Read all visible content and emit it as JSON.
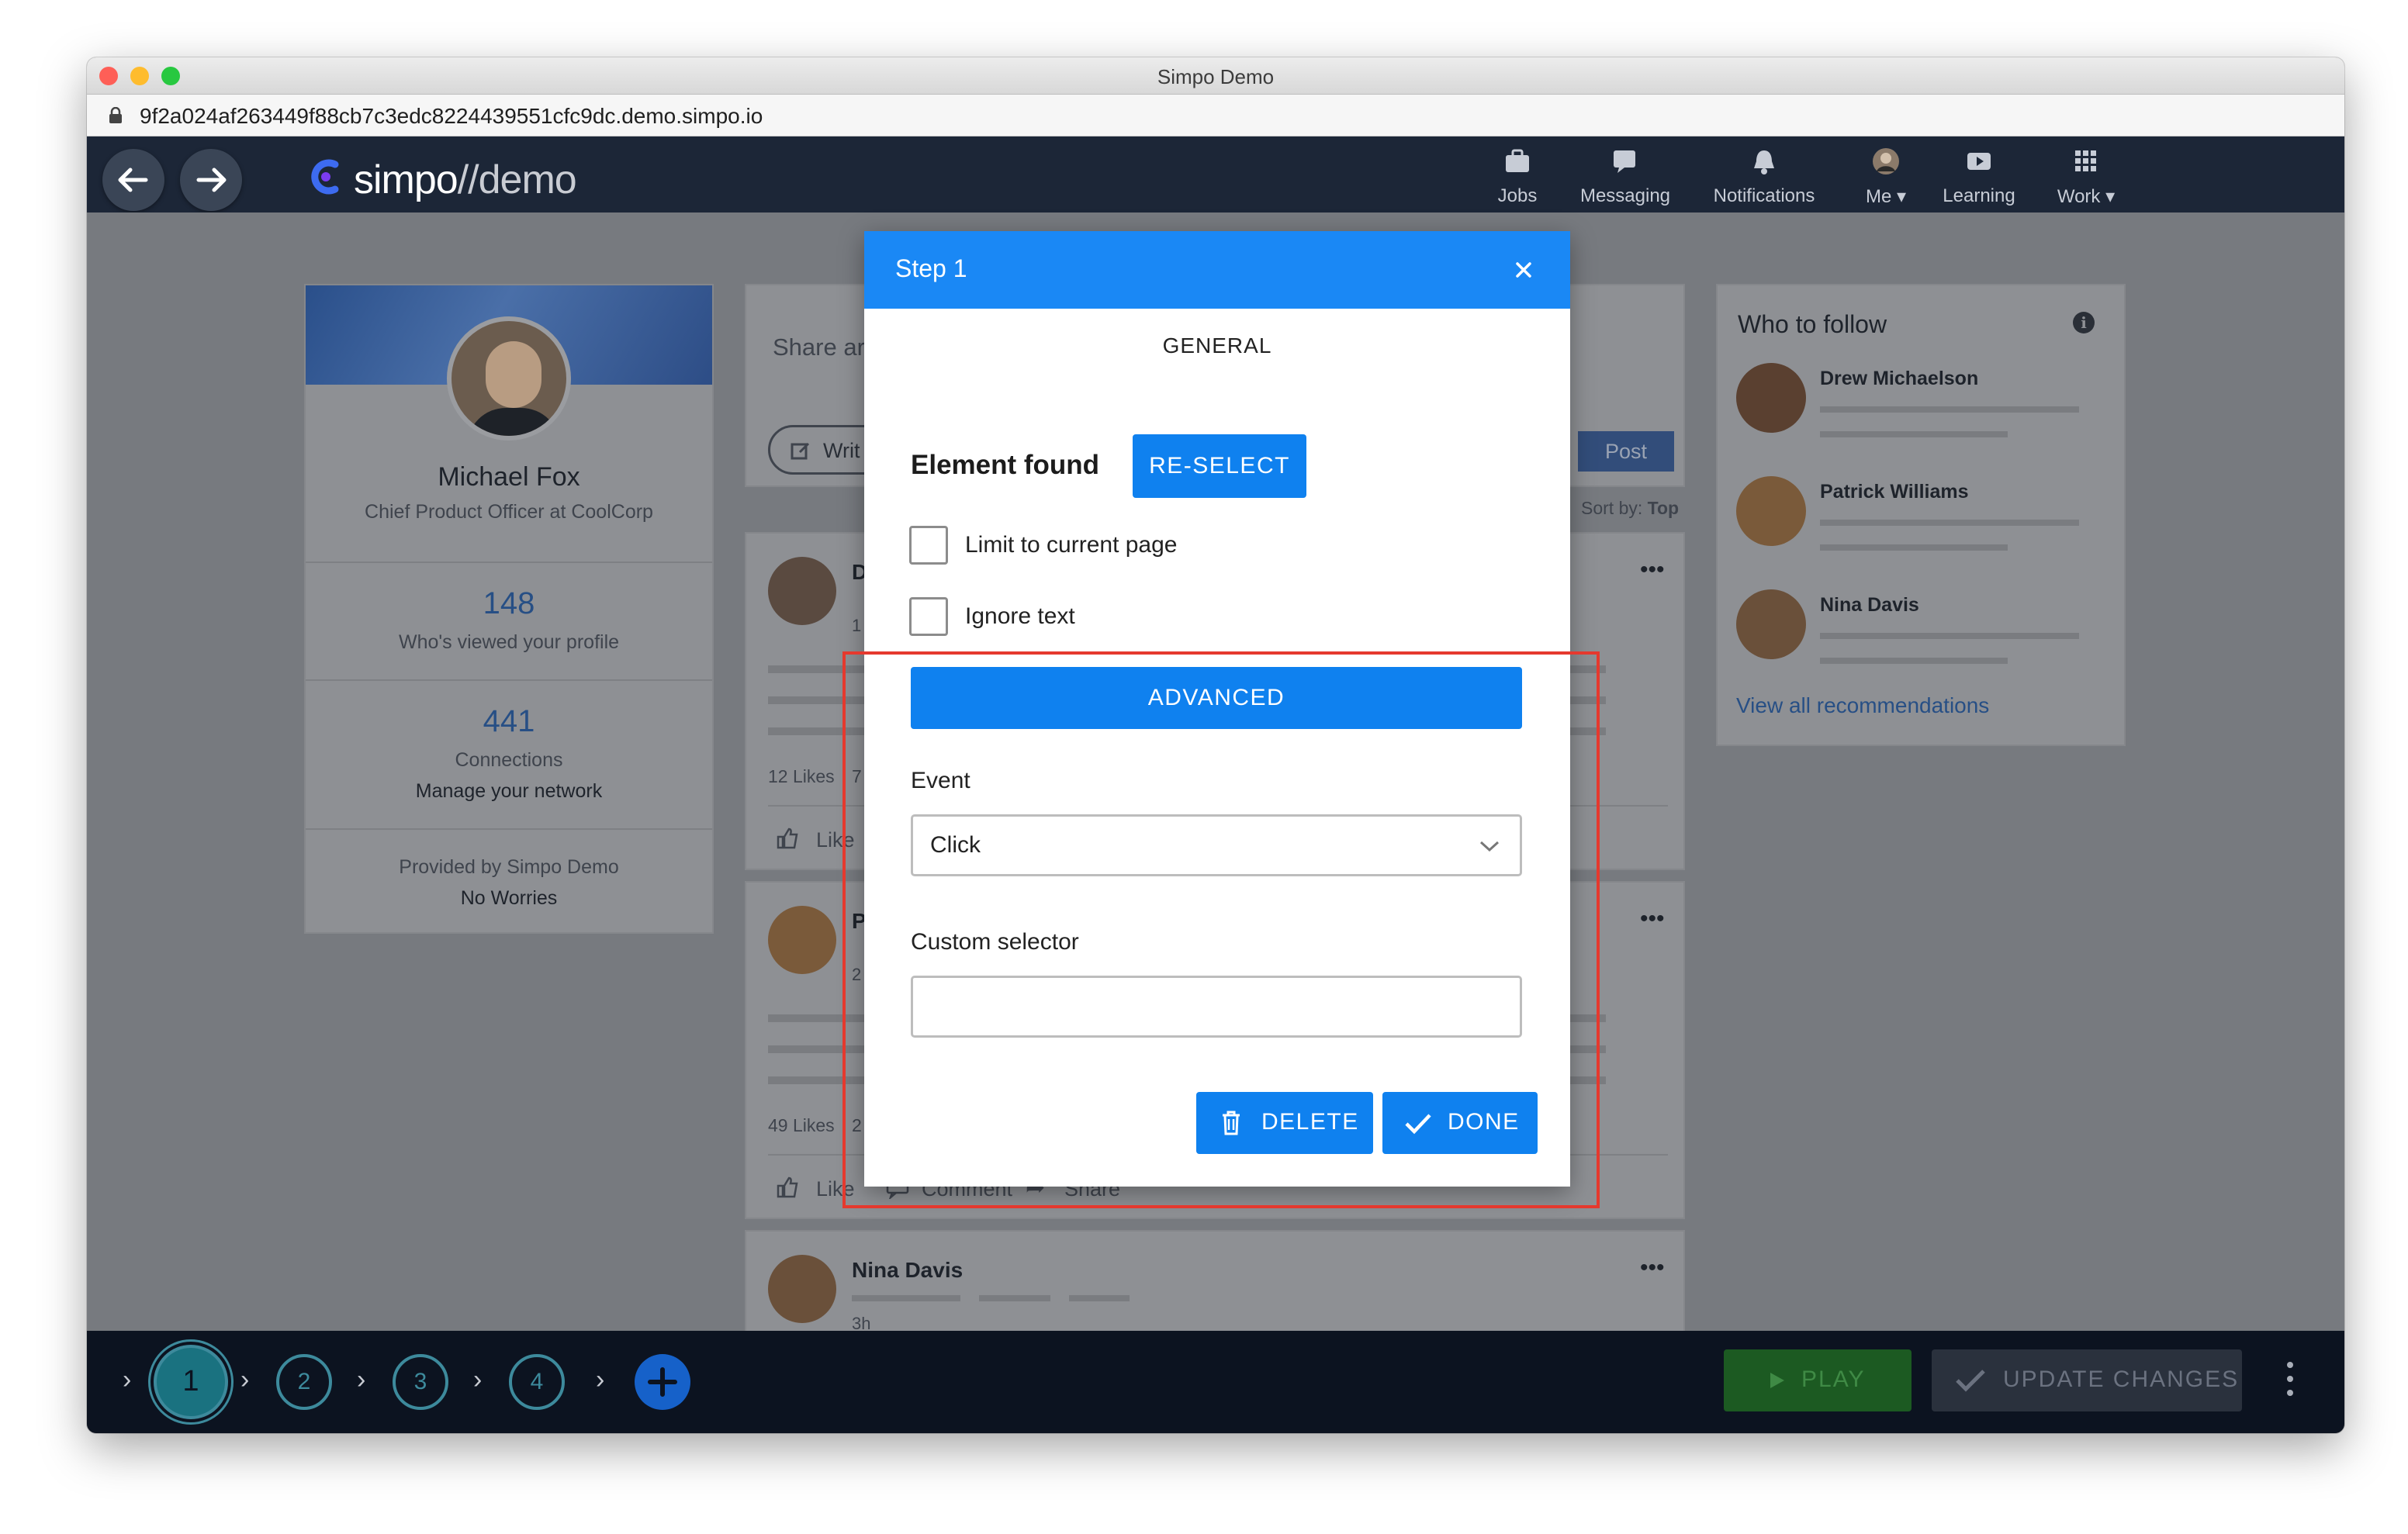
{
  "window": {
    "title": "Simpo Demo",
    "url": "9f2a024af263449f88cb7c3edc8224439551cfc9dc.demo.simpo.io"
  },
  "app": {
    "logo_main": "simpo",
    "logo_suffix": "//demo",
    "nav": [
      {
        "label": "Jobs",
        "icon": "briefcase-icon"
      },
      {
        "label": "Messaging",
        "icon": "chat-icon"
      },
      {
        "label": "Notifications",
        "icon": "bell-icon"
      },
      {
        "label": "Me ▾",
        "icon": "avatar-icon"
      },
      {
        "label": "Learning",
        "icon": "play-icon"
      },
      {
        "label": "Work ▾",
        "icon": "grid-icon"
      }
    ]
  },
  "profile": {
    "name": "Michael Fox",
    "title": "Chief Product Officer at CoolCorp",
    "views_count": "148",
    "views_label": "Who's viewed your profile",
    "connections_count": "441",
    "connections_label": "Connections",
    "manage_link": "Manage your network",
    "provided_label": "Provided by Simpo Demo",
    "provided_value": "No Worries"
  },
  "feed": {
    "share_placeholder": "Share ar",
    "write_label": "Writ",
    "post_button": "Post",
    "sort_label": "Sort by:",
    "sort_value": "Top",
    "posts": [
      {
        "author": "D",
        "meta": "1",
        "likes": "12 Likes",
        "comments_count": "7",
        "like_label": "Like",
        "comment_label": "",
        "share_label": ""
      },
      {
        "author": "P",
        "meta": "2",
        "likes": "49 Likes",
        "comments_count": "2",
        "like_label": "Like",
        "comment_label": "Comment",
        "share_label": "Share"
      },
      {
        "author": "Nina Davis",
        "meta": "3h"
      }
    ]
  },
  "follow": {
    "title": "Who to follow",
    "people": [
      "Drew Michaelson",
      "Patrick Williams",
      "Nina Davis"
    ],
    "view_all": "View all recommendations"
  },
  "modal": {
    "title": "Step 1",
    "tab": "GENERAL",
    "element_found": "Element found",
    "reselect": "RE-SELECT",
    "limit_label": "Limit to current page",
    "ignore_label": "Ignore text",
    "advanced": "ADVANCED",
    "event_label": "Event",
    "event_value": "Click",
    "custom_selector_label": "Custom selector",
    "custom_selector_value": "",
    "delete": "DELETE",
    "done": "DONE"
  },
  "bottom": {
    "steps": [
      "1",
      "2",
      "3",
      "4"
    ],
    "play": "PLAY",
    "update": "UPDATE CHANGES"
  },
  "colors": {
    "accent": "#1a88f5",
    "nav_bg": "#1c2637",
    "play_green": "#2e7d32",
    "highlight_red": "#e5392e"
  }
}
